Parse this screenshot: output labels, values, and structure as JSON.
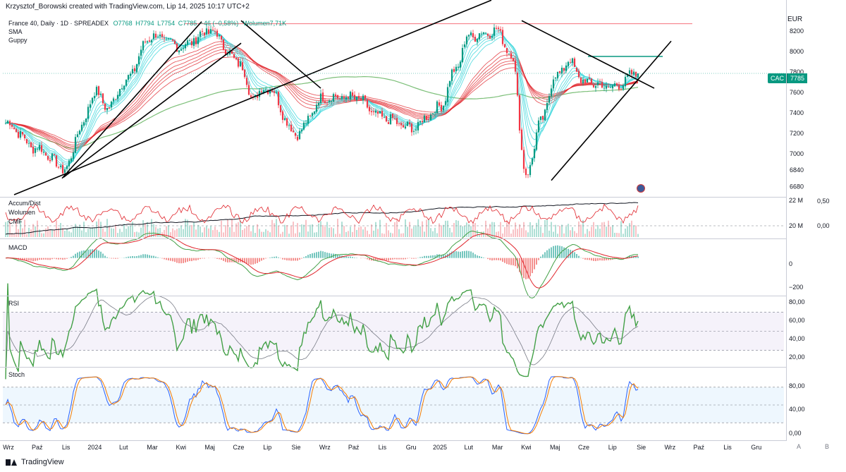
{
  "header": {
    "credit": "Krzysztof_Borowski created with TradingView.com, Lip 14, 2025 10:17 UTC+2",
    "symbol_line": {
      "title": "France 40, Daily · 1D · SPREADEX",
      "open": "O7768",
      "high": "H7794",
      "low": "L7754",
      "close": "C7785",
      "change": "−46 (−0,58%)",
      "volume": "Wolumen7,71K"
    },
    "overlay_labels": [
      "SMA",
      "Guppy"
    ],
    "currency": "EUR",
    "price_tag": {
      "symbol": "CAC",
      "price": "7785"
    }
  },
  "panes": {
    "accum_labels": [
      "Accum/Dist",
      "Wolumen",
      "CMF"
    ],
    "accum_scale": [
      "22 M",
      "20 M"
    ],
    "cmf_scale": [
      "0,50",
      "0,00"
    ],
    "macd_label": "MACD",
    "macd_scale": [
      "0",
      "−200"
    ],
    "rsi_label": "RSI",
    "rsi_scale": [
      "80,00",
      "60,00",
      "40,00",
      "20,00"
    ],
    "stoch_label": "Stoch",
    "stoch_scale": [
      "80,00",
      "40,00",
      "0,00"
    ]
  },
  "footer": {
    "brand": "TradingView",
    "buttons": [
      "A",
      "B"
    ]
  },
  "colors": {
    "up": "#089981",
    "down": "#f23645",
    "sma": "#7cbf78",
    "ribbon_red": "#e0242b",
    "ribbon_cyan": "#2bd3d8",
    "rsi": "#43a047",
    "stoch_k": "#2962ff",
    "stoch_d": "#f57c00",
    "trendline": "#000000"
  },
  "chart_data": {
    "type": "candlestick",
    "title": "France 40, Daily · 1D · SPREADEX",
    "x_axis": {
      "tick_labels": [
        "Wrz",
        "Paź",
        "Lis",
        "2024",
        "Lut",
        "Mar",
        "Kwi",
        "Maj",
        "Cze",
        "Lip",
        "Sie",
        "Wrz",
        "Paź",
        "Lis",
        "Gru",
        "2025",
        "Lut",
        "Mar",
        "Kwi",
        "Maj",
        "Cze",
        "Lip",
        "Sie",
        "Wrz",
        "Paź",
        "Lis",
        "Gru"
      ]
    },
    "y_axis": {
      "tick_labels": [
        8200,
        8000,
        7800,
        7600,
        7400,
        7200,
        7000,
        6840,
        6680
      ],
      "range": [
        6600,
        8350
      ]
    },
    "price_path_months": [
      {
        "m": "Wrz",
        "p": 7300
      },
      {
        "m": "Paź",
        "p": 7050
      },
      {
        "m": "Lis",
        "p": 6850
      },
      {
        "m": "Lis",
        "p": 7250
      },
      {
        "m": "2024",
        "p": 7600
      },
      {
        "m": "2024",
        "p": 7450
      },
      {
        "m": "Lut",
        "p": 7700
      },
      {
        "m": "Mar",
        "p": 8150
      },
      {
        "m": "Kwi",
        "p": 8050
      },
      {
        "m": "Maj",
        "p": 8200
      },
      {
        "m": "Cze",
        "p": 7900
      },
      {
        "m": "Cze",
        "p": 7550
      },
      {
        "m": "Lip",
        "p": 7650
      },
      {
        "m": "Sie",
        "p": 7200
      },
      {
        "m": "Wrz",
        "p": 7550
      },
      {
        "m": "Paź",
        "p": 7550
      },
      {
        "m": "Lis",
        "p": 7350
      },
      {
        "m": "Gru",
        "p": 7250
      },
      {
        "m": "2025",
        "p": 7450
      },
      {
        "m": "2025",
        "p": 7800
      },
      {
        "m": "Lut",
        "p": 8150
      },
      {
        "m": "Mar",
        "p": 8200
      },
      {
        "m": "Mar",
        "p": 7950
      },
      {
        "m": "Kwi",
        "p": 6780
      },
      {
        "m": "Kwi",
        "p": 7300
      },
      {
        "m": "Maj",
        "p": 7750
      },
      {
        "m": "Maj",
        "p": 7900
      },
      {
        "m": "Cze",
        "p": 7700
      },
      {
        "m": "Lip",
        "p": 7650
      },
      {
        "m": "Lip",
        "p": 7785
      }
    ],
    "last_close": 7785,
    "horizontal_lines": [
      8270,
      7950
    ],
    "indicators": {
      "rsi": {
        "upper": 70,
        "lower": 30,
        "mid": 50,
        "range": [
          15,
          85
        ]
      },
      "stoch": {
        "upper": 80,
        "lower": 20,
        "mid": 50,
        "range": [
          0,
          100
        ]
      },
      "macd": {
        "range": [
          -260,
          130
        ]
      }
    }
  }
}
